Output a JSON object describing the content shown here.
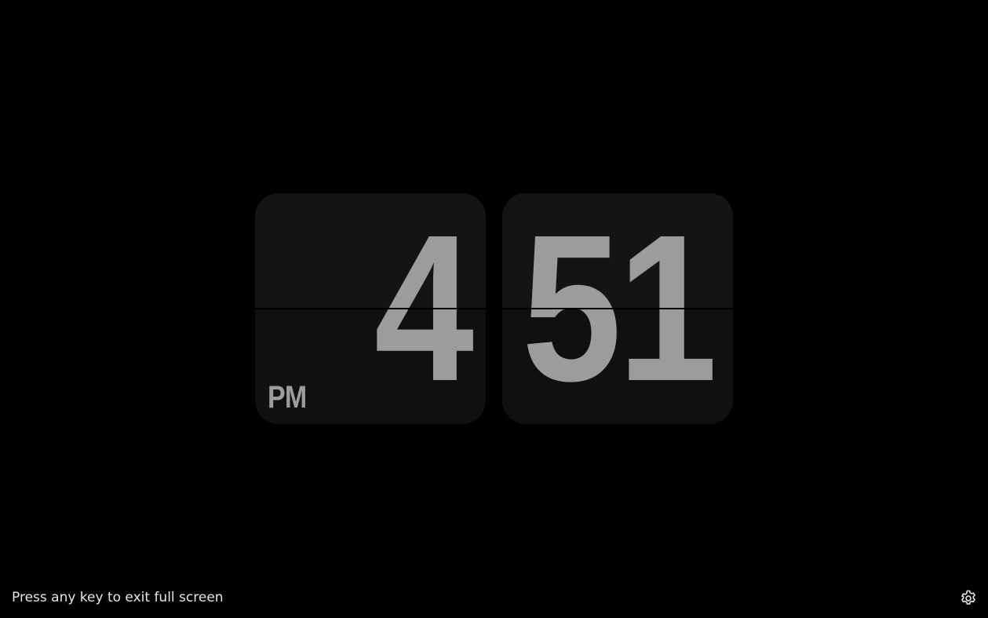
{
  "clock": {
    "hours": "4",
    "minutes": "51",
    "period": "PM"
  },
  "footer": {
    "hint": "Press any key to exit full screen"
  },
  "icons": {
    "settings": "gear-icon"
  },
  "colors": {
    "background": "#000000",
    "card": "#121212",
    "digits": "#9c9c9c",
    "hint_text": "#e6e6e6"
  }
}
